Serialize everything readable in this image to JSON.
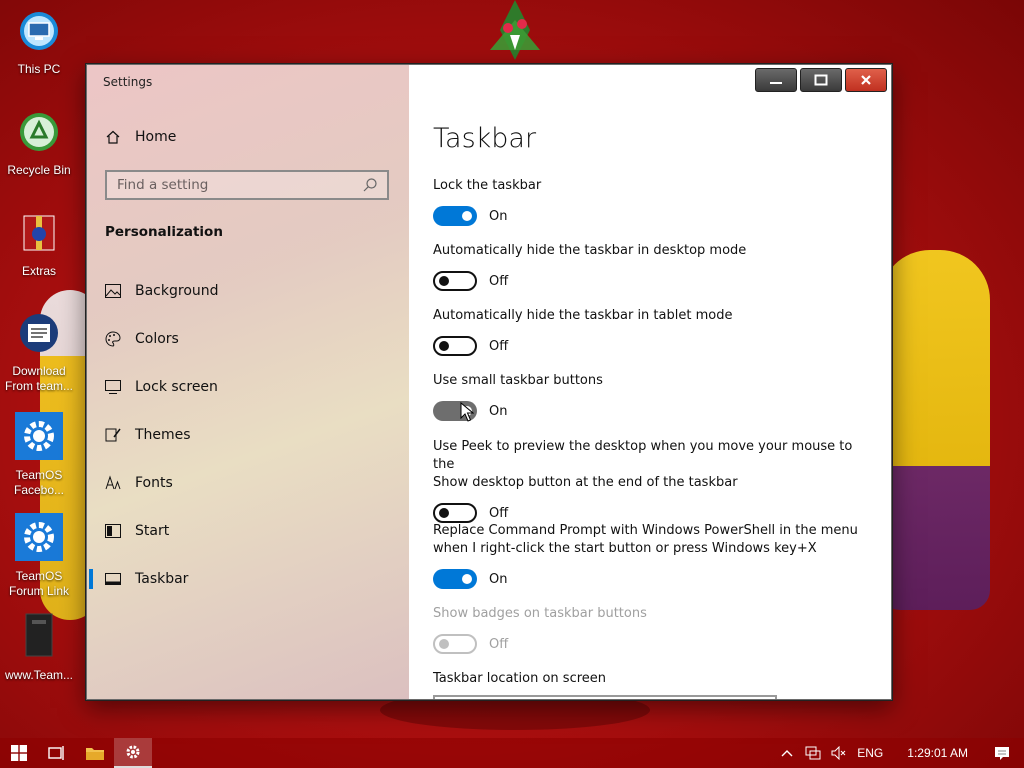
{
  "desktop": {
    "icons": [
      {
        "label": "This PC"
      },
      {
        "label": "Recycle Bin"
      },
      {
        "label": "Extras"
      },
      {
        "label_line1": "Download",
        "label_line2": "From team..."
      },
      {
        "label_line1": "TeamOS",
        "label_line2": "Facebo..."
      },
      {
        "label_line1": "TeamOS",
        "label_line2": "Forum Link"
      },
      {
        "label": "www.Team..."
      }
    ]
  },
  "window": {
    "title": "Settings",
    "sidebar": {
      "home_label": "Home",
      "search_placeholder": "Find a setting",
      "section_title": "Personalization",
      "items": [
        {
          "label": "Background",
          "icon": "picture-icon"
        },
        {
          "label": "Colors",
          "icon": "palette-icon"
        },
        {
          "label": "Lock screen",
          "icon": "monitor-lock-icon"
        },
        {
          "label": "Themes",
          "icon": "brush-icon"
        },
        {
          "label": "Fonts",
          "icon": "font-icon"
        },
        {
          "label": "Start",
          "icon": "start-icon"
        },
        {
          "label": "Taskbar",
          "icon": "taskbar-icon",
          "selected": true
        }
      ]
    },
    "content": {
      "title": "Taskbar",
      "settings": [
        {
          "label": "Lock the taskbar",
          "state": "On",
          "on": true
        },
        {
          "label": "Automatically hide the taskbar in desktop mode",
          "state": "Off",
          "on": false
        },
        {
          "label": "Automatically hide the taskbar in tablet mode",
          "state": "Off",
          "on": false
        },
        {
          "label": "Use small taskbar buttons",
          "state": "On",
          "on": true,
          "hovered": true
        },
        {
          "label_line1": "Use Peek to preview the desktop when you move your mouse to the",
          "label_line2": "Show desktop button at the end of the taskbar",
          "state": "Off",
          "on": false
        },
        {
          "label_line1": "Replace Command Prompt with Windows PowerShell in the menu",
          "label_line2": "when I right-click the start button or press Windows key+X",
          "state": "On",
          "on": true
        },
        {
          "label": "Show badges on taskbar buttons",
          "state": "Off",
          "on": false,
          "disabled": true
        },
        {
          "label": "Taskbar location on screen"
        }
      ]
    }
  },
  "taskbar": {
    "language": "ENG",
    "time": "1:29:01 AM"
  },
  "colors": {
    "accent": "#0078d7",
    "desktop_red": "#c01414"
  }
}
